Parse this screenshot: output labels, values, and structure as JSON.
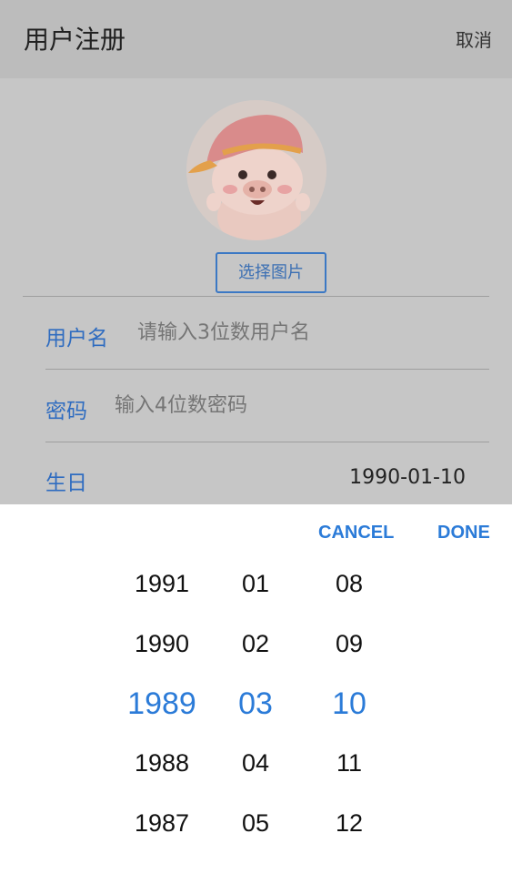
{
  "header": {
    "title": "用户注册",
    "cancel_label": "取消"
  },
  "avatar": {
    "pick_label": "选择图片"
  },
  "form": {
    "username": {
      "label": "用户名",
      "placeholder": "请输入3位数用户名"
    },
    "password": {
      "label": "密码",
      "placeholder": "输入4位数密码"
    },
    "birthday": {
      "label": "生日",
      "value": "1990-01-10"
    }
  },
  "picker": {
    "cancel_label": "CANCEL",
    "done_label": "DONE",
    "years": [
      "1991",
      "1990",
      "1989",
      "1988",
      "1987"
    ],
    "months": [
      "01",
      "02",
      "03",
      "04",
      "05"
    ],
    "days": [
      "08",
      "09",
      "10",
      "11",
      "12"
    ],
    "selected": {
      "year": "1989",
      "month": "03",
      "day": "10"
    },
    "accent_color": "#2b7bd8"
  }
}
